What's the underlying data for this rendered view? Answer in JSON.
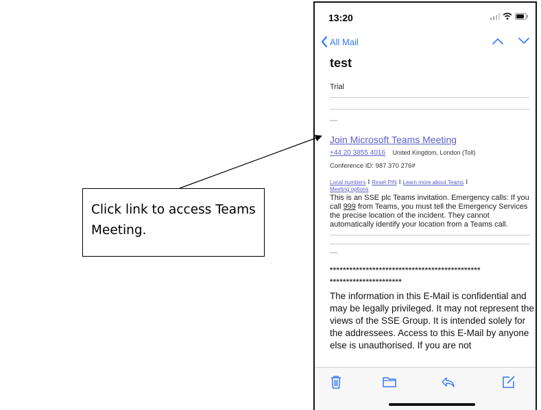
{
  "callout": {
    "line1": "Click link to access Teams",
    "line2": "Meeting."
  },
  "status_bar": {
    "time": "13:20"
  },
  "nav": {
    "back_label": "All Mail"
  },
  "email": {
    "subject": "test",
    "body_first_line": "Trial",
    "dash1": "—",
    "teams_link": "Join Microsoft Teams Meeting",
    "phone_number": "+44 20 3855 4016",
    "phone_location": "United Kingdom, London (Toll)",
    "conference_id": "Conference ID: 987 370 276#",
    "links": {
      "local_numbers": "Local numbers",
      "reset_pin": "Reset PIN",
      "learn_more": "Learn more about Teams",
      "meeting_options": "Meeting options",
      "separator": "I"
    },
    "invitation_before": "This is an SSE plc Teams invitation. Emergency calls: If you call ",
    "invitation_number": "999",
    "invitation_after": " from Teams, you must tell the Emergency Services the precise location of the incident. They cannot automatically identify your location from a Teams call.",
    "dash2": "—",
    "stars_line1": "**********************************************",
    "stars_line2": "**********************",
    "disclaimer": "The information in this E-Mail is confidential and may be legally privileged. It may not represent the views of the SSE Group. It is intended solely for the addressees. Access to this E-Mail by anyone else is unauthorised. If you are not"
  },
  "icons": {
    "trash": "trash-icon",
    "folder": "folder-icon",
    "reply": "reply-icon",
    "compose": "compose-icon"
  },
  "colors": {
    "link": "#5b5fc7",
    "ios_blue": "#3478f6"
  }
}
